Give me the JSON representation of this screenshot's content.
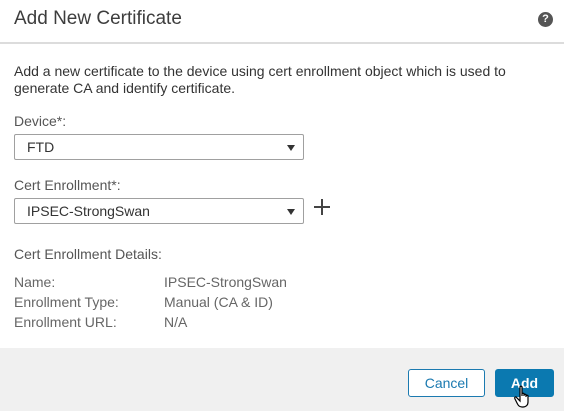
{
  "dialog": {
    "title": "Add New Certificate",
    "help_icon": "question-icon",
    "help_glyph": "?"
  },
  "body": {
    "description": "Add a new certificate to the device using cert enrollment object which is used to generate CA and identify certificate.",
    "device_label": "Device*:",
    "device_value": "FTD",
    "enrollment_label": "Cert Enrollment*:",
    "enrollment_value": "IPSEC-StrongSwan",
    "add_enrollment_icon": "plus-icon",
    "details_title": "Cert Enrollment Details:",
    "details": [
      {
        "key": "Name:",
        "value": "IPSEC-StrongSwan"
      },
      {
        "key": "Enrollment Type:",
        "value": "Manual (CA & ID)"
      },
      {
        "key": "Enrollment URL:",
        "value": "N/A"
      }
    ]
  },
  "footer": {
    "cancel_label": "Cancel",
    "add_label": "Add"
  },
  "colors": {
    "primary": "#0b79b0",
    "footer_bg": "#f0f0f0"
  }
}
